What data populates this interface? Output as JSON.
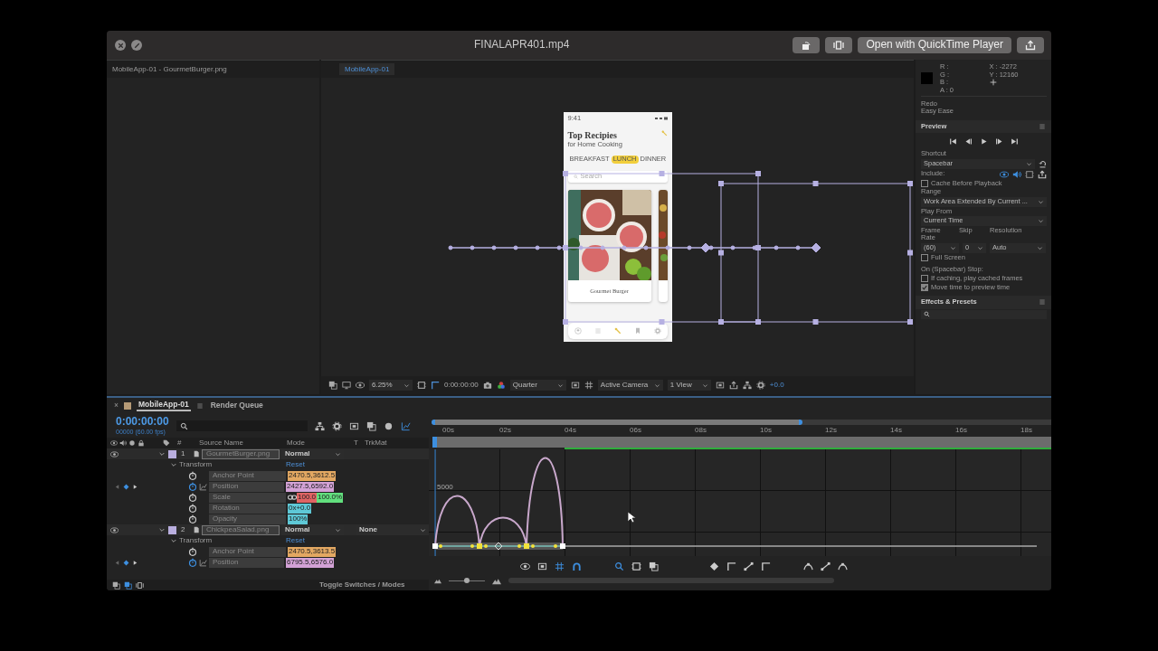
{
  "window": {
    "title": "FINALAPR401.mp4",
    "open_button": "Open with QuickTime Player"
  },
  "project_panel": {
    "tab": "MobileApp-01 - GourmetBurger.png"
  },
  "viewer": {
    "tab": "MobileApp-01",
    "mockup": {
      "time": "9:41",
      "title": "Top Recipies",
      "subtitle": "for Home Cooking",
      "tabs": [
        {
          "label": "BREAKFAST",
          "selected": false
        },
        {
          "label": "LUNCH",
          "selected": true
        },
        {
          "label": "DINNER",
          "selected": false
        }
      ],
      "search": {
        "placeholder": "Search"
      },
      "card": {
        "title": "Gourmet Burger"
      },
      "nav": [
        {
          "kind": "profile",
          "selected": false
        },
        {
          "kind": "list",
          "selected": false
        },
        {
          "kind": "spoon",
          "selected": true
        },
        {
          "kind": "bookmark",
          "selected": false
        },
        {
          "kind": "settings",
          "selected": false
        }
      ]
    },
    "toolbar": {
      "zoom": "6.25%",
      "timecode": "0:00:00:00",
      "resolution": "Quarter",
      "camera": "Active Camera",
      "views": "1 View",
      "exposure": "+0.0"
    }
  },
  "info": {
    "channels": [
      "R :",
      "G :",
      "B :",
      "A : 0"
    ],
    "x": "X : -2272",
    "y": "Y : 12160",
    "history": [
      "Redo",
      "Easy Ease"
    ]
  },
  "preview": {
    "title": "Preview",
    "shortcut_label": "Shortcut",
    "shortcut": "Spacebar",
    "include_label": "Include:",
    "include": [
      {
        "kind": "video",
        "on": true
      },
      {
        "kind": "audio",
        "on": true
      },
      {
        "kind": "overlays",
        "on": false
      }
    ],
    "cache_before_playback": {
      "label": "Cache Before Playback",
      "checked": false
    },
    "range_label": "Range",
    "range": "Work Area Extended By Current ...",
    "play_from_label": "Play From",
    "play_from": "Current Time",
    "frame_rate_label": "Frame Rate",
    "skip_label": "Skip",
    "resolution_label": "Resolution",
    "frame_rate": "(60)",
    "skip": "0",
    "resolution": "Auto",
    "full_screen": {
      "label": "Full Screen",
      "checked": false
    },
    "stop_label": "On (Spacebar) Stop:",
    "stop_options": [
      {
        "label": "If caching, play cached frames",
        "checked": false
      },
      {
        "label": "Move time to preview time",
        "checked": true
      }
    ]
  },
  "effects": {
    "title": "Effects & Presets"
  },
  "timeline": {
    "tabs": [
      {
        "label": "MobileApp-01",
        "selected": true,
        "close": "×"
      },
      {
        "label": "Render Queue",
        "selected": false
      }
    ],
    "timecode": "0:00:00:00",
    "frame_info": "00000 (60.00 fps)",
    "columns": {
      "number": "#",
      "source": "Source Name",
      "mode": "Mode",
      "t": "T",
      "trkmat": "TrkMat"
    },
    "layers": [
      {
        "number": "1",
        "name": "GourmetBurger.png",
        "color": "#b9aede",
        "visible": true,
        "mode": "Normal",
        "transform": "Transform",
        "reset": "Reset",
        "properties": [
          {
            "name": "Anchor Point",
            "animated": false,
            "values": [
              {
                "text": "2470.5,3612.5",
                "color": "#e3a862"
              }
            ]
          },
          {
            "name": "Position",
            "animated": true,
            "values": [
              {
                "text": "2427.5,6592.0",
                "color": "#d3a2d6"
              }
            ]
          },
          {
            "name": "Scale",
            "animated": false,
            "linked": true,
            "values": [
              {
                "text": "100.0",
                "color": "#e06464"
              },
              {
                "text": "100.0%",
                "color": "#62e07e"
              }
            ]
          },
          {
            "name": "Rotation",
            "animated": false,
            "values": [
              {
                "text": "0x+0.0",
                "color": "#5ec8d6"
              }
            ]
          },
          {
            "name": "Opacity",
            "animated": false,
            "values": [
              {
                "text": "100%",
                "color": "#5ec8d6"
              }
            ]
          }
        ]
      },
      {
        "number": "2",
        "name": "ChickpeaSalad.png",
        "color": "#b9aede",
        "visible": true,
        "mode": "Normal",
        "trkmat": "None",
        "transform": "Transform",
        "reset": "Reset",
        "properties": [
          {
            "name": "Anchor Point",
            "animated": false,
            "values": [
              {
                "text": "2470.5,3613.5",
                "color": "#e3a862"
              }
            ]
          },
          {
            "name": "Position",
            "animated": true,
            "values": [
              {
                "text": "6795.5,6576.0",
                "color": "#d3a2d6"
              }
            ]
          }
        ]
      }
    ],
    "footer": "Toggle Switches / Modes",
    "ruler": [
      "00s",
      "02s",
      "04s",
      "06s",
      "08s",
      "10s",
      "12s",
      "14s",
      "16s",
      "18s"
    ],
    "graph_label": "5000"
  }
}
